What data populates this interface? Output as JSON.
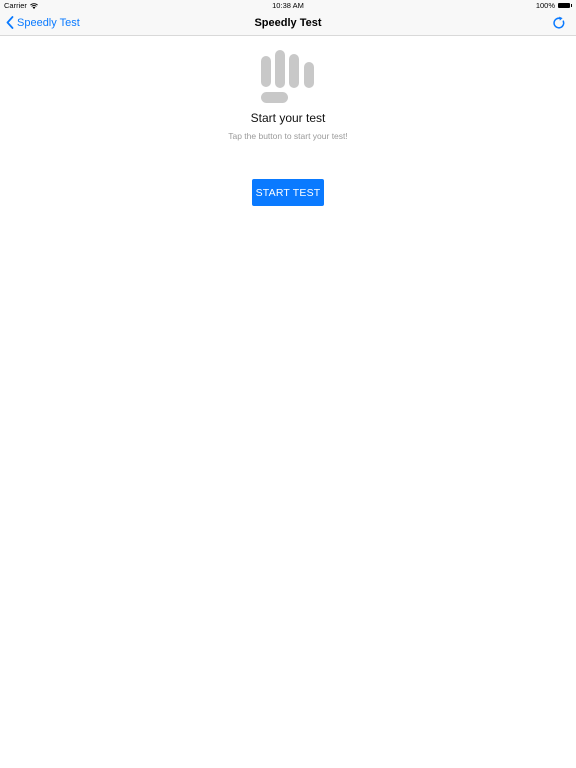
{
  "status_bar": {
    "carrier": "Carrier",
    "time": "10:38 AM",
    "battery_percent": "100%",
    "battery_level": 1.0,
    "icons": [
      "wifi-icon",
      "battery-icon"
    ]
  },
  "nav": {
    "back_label": "Speedly Test",
    "title": "Speedly Test",
    "icons": [
      "chevron-left-icon",
      "refresh-icon"
    ]
  },
  "content": {
    "icon": "hand-icon",
    "title": "Start your test",
    "subtitle": "Tap the button to start your test!",
    "button_label": "START TEST"
  },
  "colors": {
    "accent": "#0a7aff",
    "icon_gray": "#c8c8c8",
    "subtitle_gray": "#9a9a9a"
  }
}
